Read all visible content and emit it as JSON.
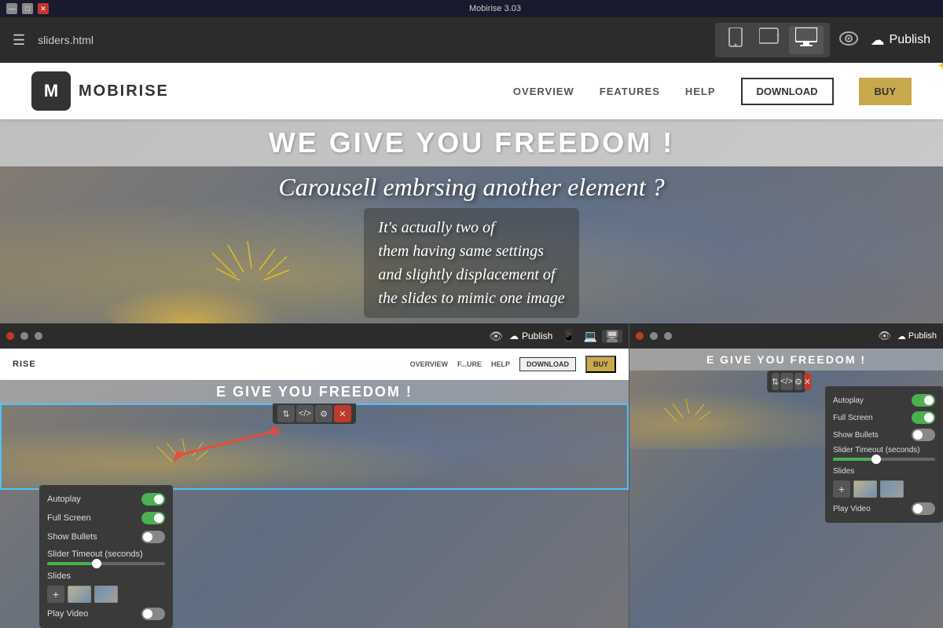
{
  "titleBar": {
    "text": "Mobirise 3.03",
    "minimizeLabel": "—",
    "maximizeLabel": "□",
    "closeLabel": "✕"
  },
  "toolbar": {
    "menuIcon": "☰",
    "filename": "sliders.html",
    "devices": [
      {
        "icon": "📱",
        "label": "mobile",
        "active": false
      },
      {
        "icon": "💻",
        "label": "tablet",
        "active": false
      },
      {
        "icon": "🖥",
        "label": "desktop",
        "active": true
      }
    ],
    "previewIcon": "👁",
    "publishCloudIcon": "☁",
    "publishLabel": "Publish"
  },
  "nav": {
    "logoText": "M",
    "brandName": "MOBIRISE",
    "links": [
      "OVERVIEW",
      "FEATURES",
      "HELP"
    ],
    "downloadLabel": "DOWNLOAD",
    "buyLabel": "BUY"
  },
  "heroSection": {
    "title": "WE GIVE YOU FREEDOM !"
  },
  "sliderOverlay": {
    "text1": "Carousell embrsing another element ?",
    "text2": "It's actually two of\nthem having same settings\nand slightly displacement of\nthe slides to mimic one image"
  },
  "settingsPanel": {
    "autoplayLabel": "Autoplay",
    "fullScreenLabel": "Full Screen",
    "showBulletsLabel": "Show Bullets",
    "sliderTimeoutLabel": "Slider Timeout (seconds)",
    "slidesLabel": "Slides",
    "playVideoLabel": "Play Video",
    "addIcon": "+"
  },
  "innerNav": {
    "brand": "RISE",
    "links": [
      "OVERVIEW",
      "F...URE",
      "HELP"
    ],
    "downloadLabel": "DOWNLOAD",
    "buyLabel": "BUY"
  },
  "innerHero": {
    "title": "E GIVE YOU FREEDOM !",
    "title2": "WE GIVE YOU FREEDOM !"
  },
  "blockToolbar": {
    "icon1": "⇅",
    "icon2": "</>",
    "icon3": "⚙",
    "icon4": "✕"
  },
  "secondPublish": "Publish",
  "firstPublish": "Publish"
}
